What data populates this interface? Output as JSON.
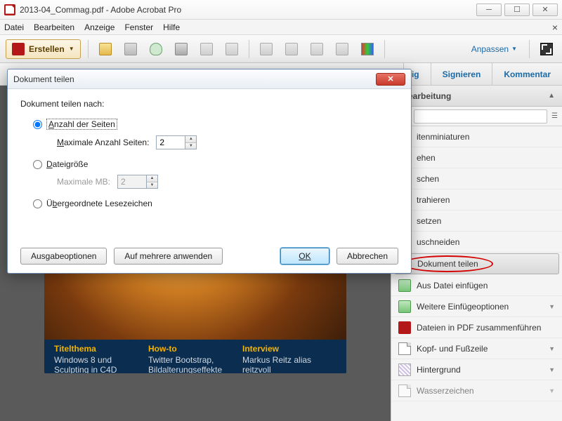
{
  "window": {
    "title": "2013-04_Commag.pdf - Adobe Acrobat Pro"
  },
  "menu": {
    "datei": "Datei",
    "bearbeiten": "Bearbeiten",
    "anzeige": "Anzeige",
    "fenster": "Fenster",
    "hilfe": "Hilfe"
  },
  "toolbar": {
    "create": "Erstellen",
    "anpassen": "Anpassen"
  },
  "tabs": {
    "partial": "dig",
    "sign": "Signieren",
    "comment": "Kommentar"
  },
  "rpanel": {
    "header": "sbearbeitung",
    "items": [
      "itenminiaturen",
      "ehen",
      "schen",
      "trahieren",
      "setzen",
      "uschneiden"
    ],
    "highlight": "Dokument teilen",
    "more": [
      "Aus Datei einfügen",
      "Weitere Einfügeoptionen",
      "Dateien in PDF zusammenführen",
      "Kopf- und Fußzeile",
      "Hintergrund",
      "Wasserzeichen"
    ]
  },
  "dialog": {
    "title": "Dokument teilen",
    "split_by": "Dokument teilen nach:",
    "opt_pages": "Anzahl der Seiten",
    "max_pages_label": "Maximale Anzahl Seiten:",
    "max_pages_value": "2",
    "opt_size": "Dateigröße",
    "max_mb_label": "Maximale MB:",
    "max_mb_value": "2",
    "opt_bookmarks": "Übergeordnete Lesezeichen",
    "btn_output": "Ausgabeoptionen",
    "btn_apply_multi": "Auf mehrere anwenden",
    "btn_ok": "OK",
    "btn_cancel": "Abbrechen"
  },
  "doc": {
    "col1h": "Titelthema",
    "col1s": "Windows 8 und Sculpting in C4D",
    "col2h": "How-to",
    "col2s": "Twitter Bootstrap, Bildalterungseffekte",
    "col3h": "Interview",
    "col3s": "Markus Reitz alias reitzvoll"
  }
}
